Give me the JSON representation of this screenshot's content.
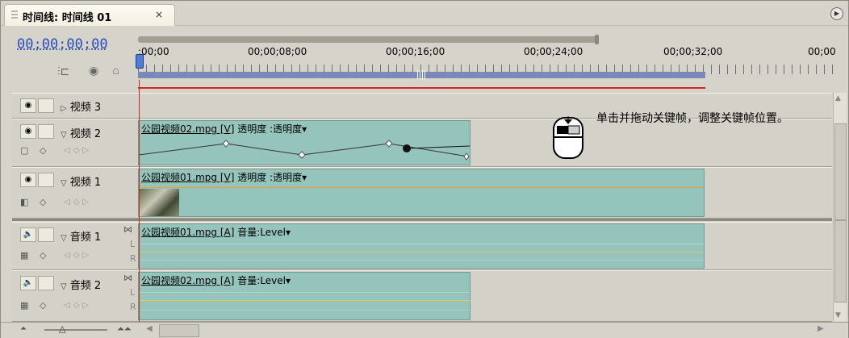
{
  "tab": {
    "title": "时间线: 时间线 01",
    "close": "×"
  },
  "timecode": "00;00;00;00",
  "ruler": {
    "labels": [
      ";00;00",
      "00;00;08;00",
      "00;00;16;00",
      "00;00;24;00",
      "00;00;32;00",
      "00;00"
    ]
  },
  "tracks": {
    "v3": {
      "name": "视频 3"
    },
    "v2": {
      "name": "视频 2",
      "clip": "公园视频02.mpg [V]",
      "effect": "透明度 :透明度"
    },
    "v1": {
      "name": "视频 1",
      "clip": "公园视频01.mpg [V]",
      "effect": "透明度 :透明度"
    },
    "a1": {
      "name": "音频 1",
      "clip": "公园视频01.mpg [A]",
      "effect": "音量:Level"
    },
    "a2": {
      "name": "音频 2",
      "clip": "公园视频02.mpg [A]",
      "effect": "音量:Level"
    }
  },
  "annotation": {
    "text": "单击并拖动关键帧，调整关键帧位置。"
  },
  "channel_labels": {
    "left": "L",
    "right": "R"
  },
  "icons": [
    "eye-icon",
    "lock-icon",
    "speaker-icon",
    "snap-icon",
    "marker-icon",
    "mouse-icon",
    "panel-menu-icon"
  ]
}
